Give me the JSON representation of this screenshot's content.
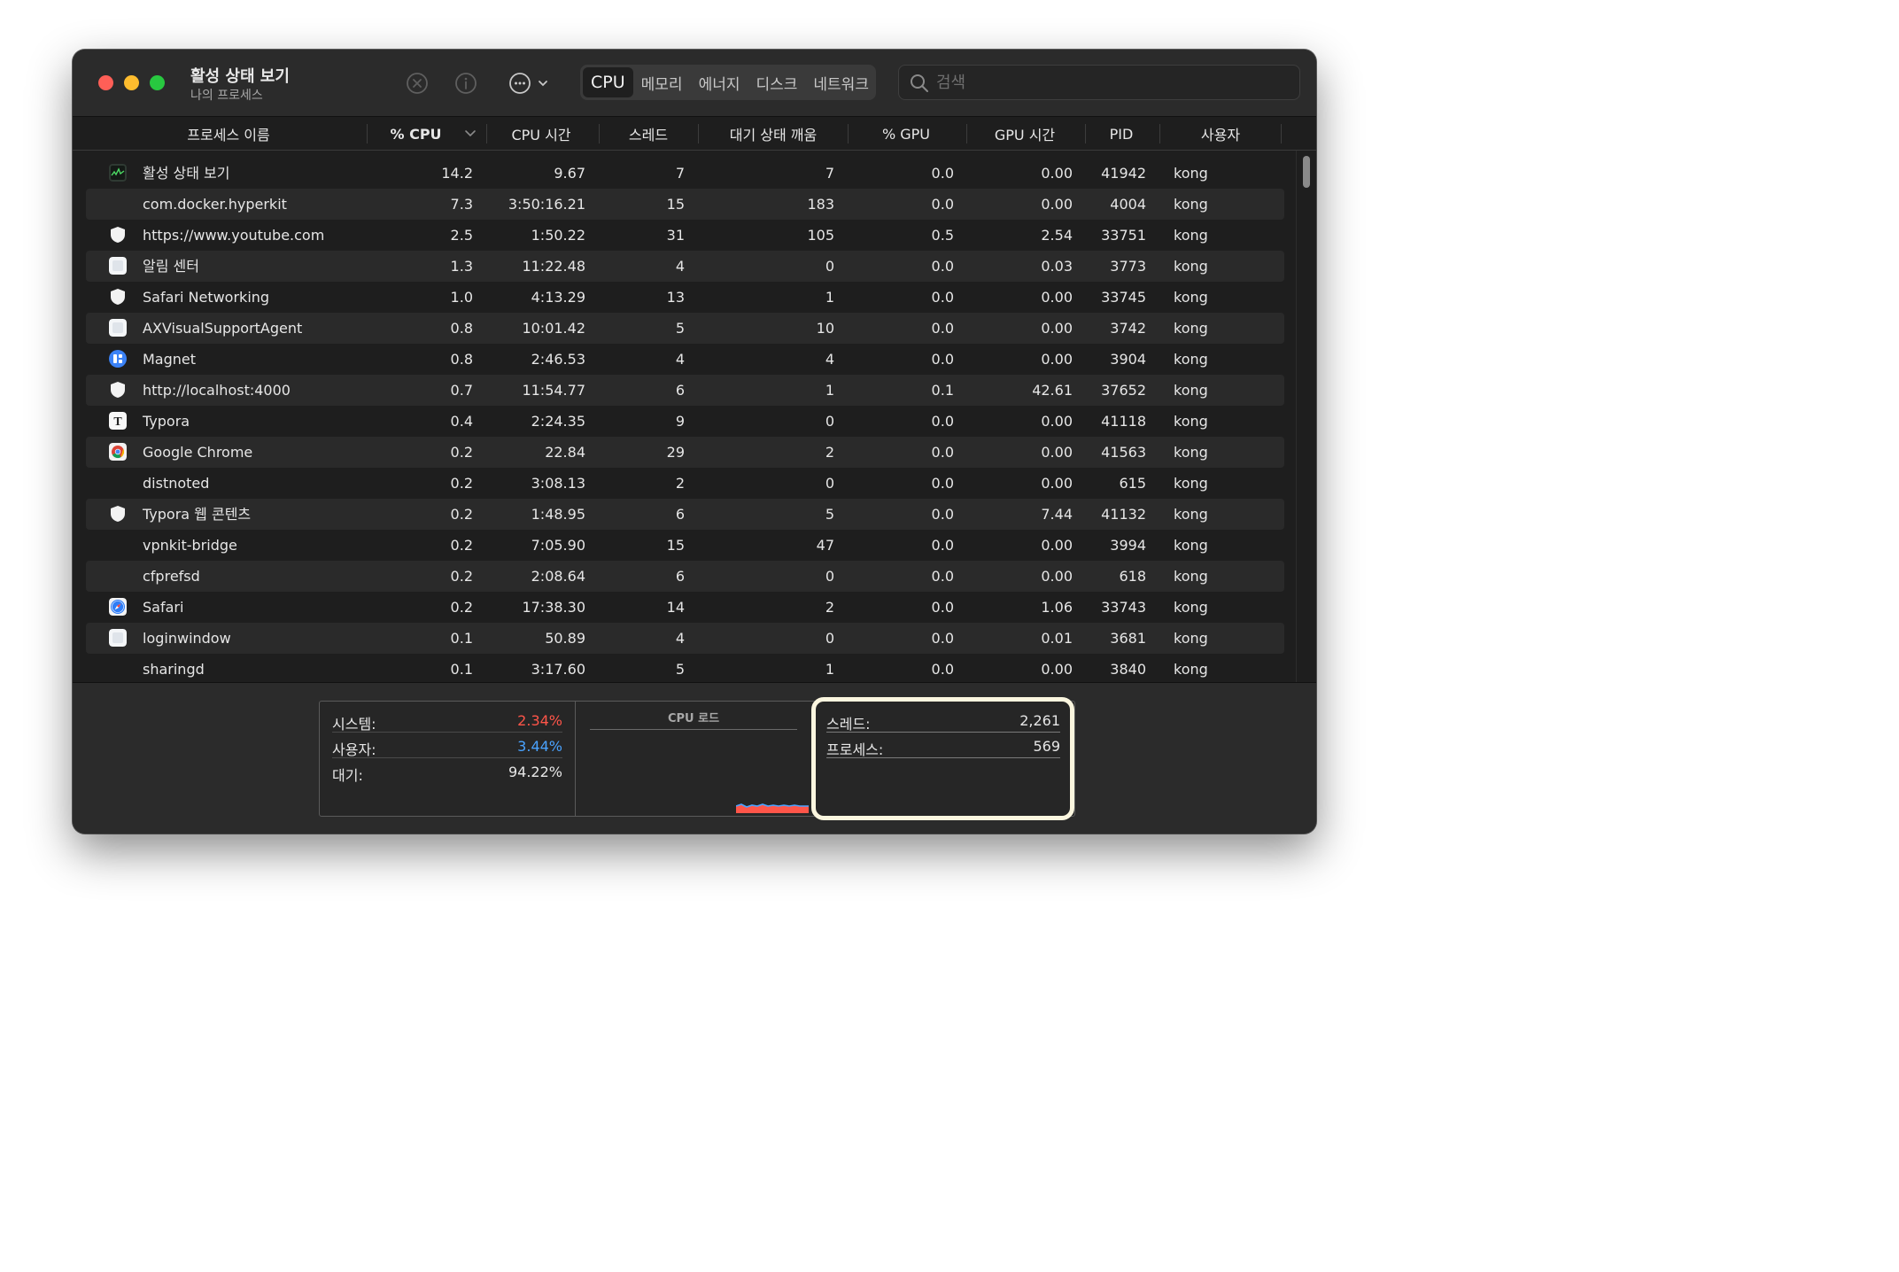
{
  "window": {
    "title": "활성 상태 보기",
    "subtitle": "나의 프로세스"
  },
  "toolbar": {
    "tabs": [
      "CPU",
      "메모리",
      "에너지",
      "디스크",
      "네트워크"
    ],
    "active_tab": "CPU",
    "search_placeholder": "검색"
  },
  "columns": [
    "프로세스 이름",
    "% CPU",
    "CPU 시간",
    "스레드",
    "대기 상태 깨움",
    "% GPU",
    "GPU 시간",
    "PID",
    "사용자"
  ],
  "processes": [
    {
      "name": "활성 상태 보기",
      "icon": "activity-monitor-icon",
      "cpu": "14.2",
      "cpu_time": "9.67",
      "threads": "7",
      "wakeups": "7",
      "gpu": "0.0",
      "gpu_time": "0.00",
      "pid": "41942",
      "user": "kong"
    },
    {
      "name": "com.docker.hyperkit",
      "icon": "",
      "cpu": "7.3",
      "cpu_time": "3:50:16.21",
      "threads": "15",
      "wakeups": "183",
      "gpu": "0.0",
      "gpu_time": "0.00",
      "pid": "4004",
      "user": "kong"
    },
    {
      "name": "https://www.youtube.com",
      "icon": "shield-icon",
      "cpu": "2.5",
      "cpu_time": "1:50.22",
      "threads": "31",
      "wakeups": "105",
      "gpu": "0.5",
      "gpu_time": "2.54",
      "pid": "33751",
      "user": "kong"
    },
    {
      "name": "알림 센터",
      "icon": "generic-app-icon",
      "cpu": "1.3",
      "cpu_time": "11:22.48",
      "threads": "4",
      "wakeups": "0",
      "gpu": "0.0",
      "gpu_time": "0.03",
      "pid": "3773",
      "user": "kong"
    },
    {
      "name": "Safari Networking",
      "icon": "shield-icon",
      "cpu": "1.0",
      "cpu_time": "4:13.29",
      "threads": "13",
      "wakeups": "1",
      "gpu": "0.0",
      "gpu_time": "0.00",
      "pid": "33745",
      "user": "kong"
    },
    {
      "name": "AXVisualSupportAgent",
      "icon": "generic-app-icon",
      "cpu": "0.8",
      "cpu_time": "10:01.42",
      "threads": "5",
      "wakeups": "10",
      "gpu": "0.0",
      "gpu_time": "0.00",
      "pid": "3742",
      "user": "kong"
    },
    {
      "name": "Magnet",
      "icon": "magnet-icon",
      "cpu": "0.8",
      "cpu_time": "2:46.53",
      "threads": "4",
      "wakeups": "4",
      "gpu": "0.0",
      "gpu_time": "0.00",
      "pid": "3904",
      "user": "kong"
    },
    {
      "name": "http://localhost:4000",
      "icon": "shield-icon",
      "cpu": "0.7",
      "cpu_time": "11:54.77",
      "threads": "6",
      "wakeups": "1",
      "gpu": "0.1",
      "gpu_time": "42.61",
      "pid": "37652",
      "user": "kong"
    },
    {
      "name": "Typora",
      "icon": "typora-icon",
      "cpu": "0.4",
      "cpu_time": "2:24.35",
      "threads": "9",
      "wakeups": "0",
      "gpu": "0.0",
      "gpu_time": "0.00",
      "pid": "41118",
      "user": "kong"
    },
    {
      "name": "Google Chrome",
      "icon": "chrome-icon",
      "cpu": "0.2",
      "cpu_time": "22.84",
      "threads": "29",
      "wakeups": "2",
      "gpu": "0.0",
      "gpu_time": "0.00",
      "pid": "41563",
      "user": "kong"
    },
    {
      "name": "distnoted",
      "icon": "",
      "cpu": "0.2",
      "cpu_time": "3:08.13",
      "threads": "2",
      "wakeups": "0",
      "gpu": "0.0",
      "gpu_time": "0.00",
      "pid": "615",
      "user": "kong"
    },
    {
      "name": "Typora 웹 콘텐츠",
      "icon": "shield-icon",
      "cpu": "0.2",
      "cpu_time": "1:48.95",
      "threads": "6",
      "wakeups": "5",
      "gpu": "0.0",
      "gpu_time": "7.44",
      "pid": "41132",
      "user": "kong"
    },
    {
      "name": "vpnkit-bridge",
      "icon": "",
      "cpu": "0.2",
      "cpu_time": "7:05.90",
      "threads": "15",
      "wakeups": "47",
      "gpu": "0.0",
      "gpu_time": "0.00",
      "pid": "3994",
      "user": "kong"
    },
    {
      "name": "cfprefsd",
      "icon": "",
      "cpu": "0.2",
      "cpu_time": "2:08.64",
      "threads": "6",
      "wakeups": "0",
      "gpu": "0.0",
      "gpu_time": "0.00",
      "pid": "618",
      "user": "kong"
    },
    {
      "name": "Safari",
      "icon": "safari-icon",
      "cpu": "0.2",
      "cpu_time": "17:38.30",
      "threads": "14",
      "wakeups": "2",
      "gpu": "0.0",
      "gpu_time": "1.06",
      "pid": "33743",
      "user": "kong"
    },
    {
      "name": "loginwindow",
      "icon": "generic-app-icon",
      "cpu": "0.1",
      "cpu_time": "50.89",
      "threads": "4",
      "wakeups": "0",
      "gpu": "0.0",
      "gpu_time": "0.01",
      "pid": "3681",
      "user": "kong"
    },
    {
      "name": "sharingd",
      "icon": "",
      "cpu": "0.1",
      "cpu_time": "3:17.60",
      "threads": "5",
      "wakeups": "1",
      "gpu": "0.0",
      "gpu_time": "0.00",
      "pid": "3840",
      "user": "kong"
    }
  ],
  "summary": {
    "system_label": "시스템:",
    "system_value": "2.34%",
    "user_label": "사용자:",
    "user_value": "3.44%",
    "idle_label": "대기:",
    "idle_value": "94.22%",
    "cpu_load_title": "CPU 로드",
    "threads_label": "스레드:",
    "threads_value": "2,261",
    "processes_label": "프로세스:",
    "processes_value": "569"
  },
  "colors": {
    "system": "#ff5549",
    "user": "#4aa3ff",
    "highlight_border": "#fbf6df"
  }
}
